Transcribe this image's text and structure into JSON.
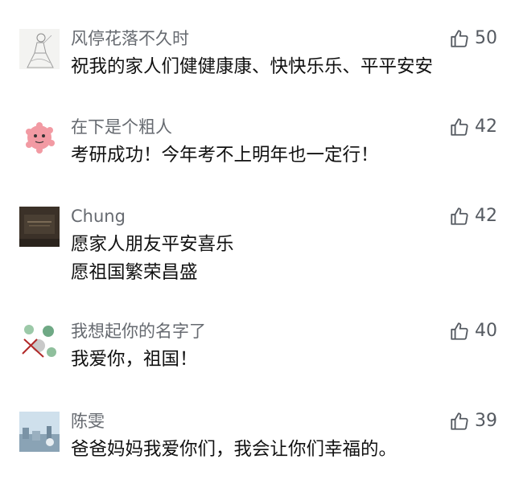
{
  "comments": [
    {
      "username": "风停花落不久时",
      "likes": "50",
      "lines": [
        "祝我的家人们健健康康、快快乐乐、平平安安"
      ],
      "avatar_icon": "sketch-girl-avatar"
    },
    {
      "username": "在下是个粗人",
      "likes": "42",
      "lines": [
        "考研成功！今年考不上明年也一定行！"
      ],
      "avatar_icon": "pink-cartoon-avatar"
    },
    {
      "username": "Chung",
      "likes": "42",
      "lines": [
        "愿家人朋友平安喜乐",
        "愿祖国繁荣昌盛"
      ],
      "avatar_icon": "dark-photo-avatar"
    },
    {
      "username": "我想起你的名字了",
      "likes": "40",
      "lines": [
        "我爱你，祖国！"
      ],
      "avatar_icon": "flower-crossed-avatar"
    },
    {
      "username": "陈雯",
      "likes": "39",
      "lines": [
        "爸爸妈妈我爱你们，我会让你们幸福的。"
      ],
      "avatar_icon": "city-photo-avatar"
    }
  ],
  "colors": {
    "username": "#666a70",
    "text": "#111111",
    "like_icon": "#555a61",
    "background": "#ffffff"
  }
}
